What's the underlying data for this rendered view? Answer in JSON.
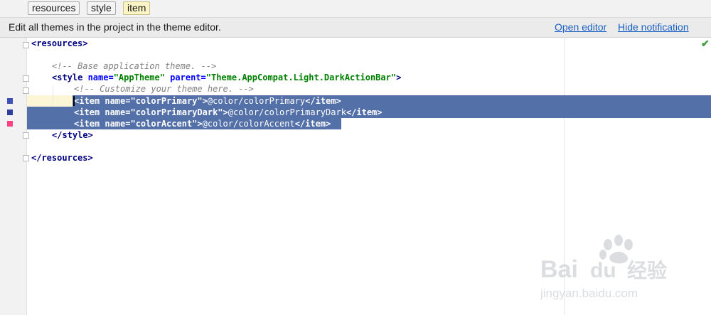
{
  "breadcrumb": {
    "items": [
      "resources",
      "style",
      "item"
    ]
  },
  "notification": {
    "message": "Edit all themes in the project in the theme editor.",
    "open_editor": "Open editor",
    "hide": "Hide notification"
  },
  "status_icon": "check-icon",
  "code": {
    "line1_tag": "<resources>",
    "line2_comment": "<!-- Base application theme. -->",
    "line3_open": "<style ",
    "line3_attr1": "name=",
    "line3_val1": "\"AppTheme\"",
    "line3_attr2": " parent=",
    "line3_val2": "\"Theme.AppCompat.Light.DarkActionBar\"",
    "line3_close": ">",
    "line4_comment": "<!-- Customize your theme here. -->",
    "items": [
      {
        "open": "<item ",
        "attr": "name=",
        "val": "\"colorPrimary\"",
        "close": ">",
        "text": "@color/colorPrimary",
        "end": "</item>"
      },
      {
        "open": "<item ",
        "attr": "name=",
        "val": "\"colorPrimaryDark\"",
        "close": ">",
        "text": "@color/colorPrimaryDark",
        "end": "</item>"
      },
      {
        "open": "<item ",
        "attr": "name=",
        "val": "\"colorAccent\"",
        "close": ">",
        "text": "@color/colorAccent",
        "end": "</item>"
      }
    ],
    "line8_tag": "</style>",
    "line10_tag": "</resources>"
  },
  "colors": {
    "colorPrimary": "#3f51b5",
    "colorPrimaryDark": "#303f9f",
    "colorAccent": "#ff4081",
    "selection": "#5470a8",
    "link": "#1a5fc4"
  },
  "watermark": {
    "logo": "Bai du 经验",
    "url": "jingyan.baidu.com"
  }
}
